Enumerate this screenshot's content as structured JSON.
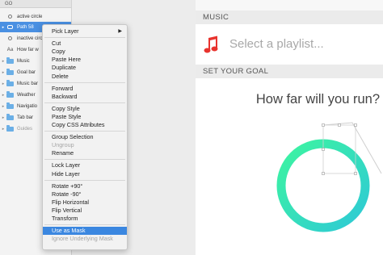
{
  "layers": {
    "header": "GO",
    "rows": [
      {
        "label": "active circle",
        "icon": "circle-icon",
        "expand": ""
      },
      {
        "label": "Path 58",
        "icon": "shape-icon",
        "expand": "▸",
        "selected": true
      },
      {
        "label": "inactive circ",
        "icon": "circle-icon",
        "expand": ""
      },
      {
        "label": "How far w",
        "icon": "text-icon",
        "expand": ""
      },
      {
        "label": "Music",
        "icon": "folder-icon",
        "expand": "▸"
      },
      {
        "label": "Goal bar",
        "icon": "folder-icon",
        "expand": "▸"
      },
      {
        "label": "Music bar",
        "icon": "folder-icon",
        "expand": "▸"
      },
      {
        "label": "Weather",
        "icon": "folder-icon",
        "expand": "▸"
      },
      {
        "label": "Navigatio",
        "icon": "folder-icon",
        "expand": "▸"
      },
      {
        "label": "Tab bar",
        "icon": "folder-icon",
        "expand": "▸"
      },
      {
        "label": "Guides",
        "icon": "folder-icon",
        "expand": "▸",
        "dim": true
      }
    ]
  },
  "artboard": {
    "music_header": "MUSIC",
    "playlist_placeholder": "Select a playlist...",
    "goal_header": "SET YOUR GOAL",
    "question": "How far will you run?",
    "accent_colors": {
      "ring_start": "#3df5a0",
      "ring_end": "#2ec9d6",
      "note": "#e8332e"
    }
  },
  "menu": {
    "items": [
      {
        "label": "Pick Layer",
        "submenu": "▶"
      },
      {
        "sep": true
      },
      {
        "label": "Cut"
      },
      {
        "label": "Copy"
      },
      {
        "label": "Paste Here"
      },
      {
        "label": "Duplicate"
      },
      {
        "label": "Delete"
      },
      {
        "sep": true
      },
      {
        "label": "Forward"
      },
      {
        "label": "Backward"
      },
      {
        "sep": true
      },
      {
        "label": "Copy Style"
      },
      {
        "label": "Paste Style"
      },
      {
        "label": "Copy CSS Attributes"
      },
      {
        "sep": true
      },
      {
        "label": "Group Selection"
      },
      {
        "label": "Ungroup",
        "disabled": true
      },
      {
        "label": "Rename"
      },
      {
        "sep": true
      },
      {
        "label": "Lock Layer"
      },
      {
        "label": "Hide Layer"
      },
      {
        "sep": true
      },
      {
        "label": "Rotate +90°"
      },
      {
        "label": "Rotate -90°"
      },
      {
        "label": "Flip Horizontal"
      },
      {
        "label": "Flip Vertical"
      },
      {
        "label": "Transform"
      },
      {
        "sep": true
      },
      {
        "label": "Use as Mask",
        "active": true
      },
      {
        "label": "Ignore Underlying Mask",
        "disabled": true
      }
    ]
  }
}
